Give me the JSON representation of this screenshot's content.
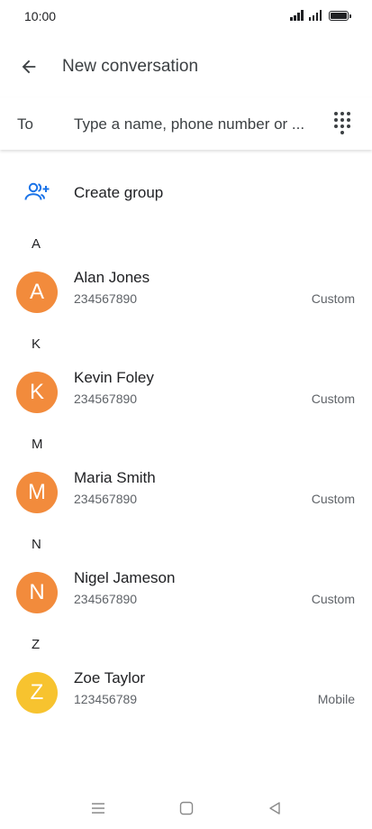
{
  "status_bar": {
    "time": "10:00",
    "icons": [
      "signal-icon",
      "signal-icon",
      "battery-icon"
    ]
  },
  "app_bar": {
    "back_icon": "arrow-left-icon",
    "title": "New conversation"
  },
  "to_row": {
    "label": "To",
    "placeholder": "Type a name, phone number or ...",
    "value": "",
    "dialpad_icon": "dialpad-icon"
  },
  "create_group": {
    "icon": "add-group-icon",
    "label": "Create group",
    "icon_color": "#1a73e8"
  },
  "sections": [
    {
      "letter": "A",
      "contacts": [
        {
          "initial": "A",
          "name": "Alan Jones",
          "number": "234567890",
          "type": "Custom",
          "color": "#f28b3c"
        }
      ]
    },
    {
      "letter": "K",
      "contacts": [
        {
          "initial": "K",
          "name": "Kevin Foley",
          "number": "234567890",
          "type": "Custom",
          "color": "#f28b3c"
        }
      ]
    },
    {
      "letter": "M",
      "contacts": [
        {
          "initial": "M",
          "name": "Maria Smith",
          "number": "234567890",
          "type": "Custom",
          "color": "#f28b3c"
        }
      ]
    },
    {
      "letter": "N",
      "contacts": [
        {
          "initial": "N",
          "name": "Nigel Jameson",
          "number": "234567890",
          "type": "Custom",
          "color": "#f28b3c"
        }
      ]
    },
    {
      "letter": "Z",
      "contacts": [
        {
          "initial": "Z",
          "name": "Zoe Taylor",
          "number": "123456789",
          "type": "Mobile",
          "color": "#f7c32f"
        }
      ]
    }
  ],
  "nav_bar": {
    "icons": [
      "menu-icon",
      "home-icon",
      "back-icon"
    ]
  }
}
